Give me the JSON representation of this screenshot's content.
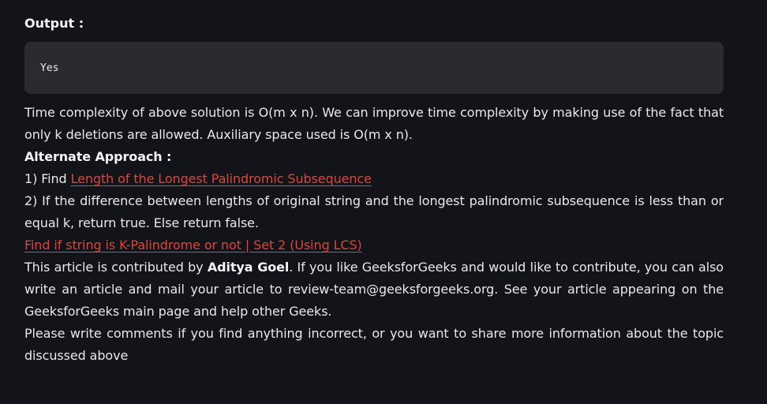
{
  "output_heading": "Output :",
  "output_code": "Yes",
  "complexity_text": "Time complexity of above solution is O(m x n). We can improve time complexity by making use of the fact that only k deletions are allowed. Auxiliary space used is O(m x n).",
  "alternate_heading": "Alternate Approach :",
  "step1_prefix": "1) Find ",
  "step1_link": "Length of the Longest Palindromic Subsequence",
  "step2_text": "2) If the difference between lengths of original string and the longest palindromic subsequence is less than or equal k, return true. Else return false.",
  "set2_link": "Find if string is K-Palindrome or not | Set 2 (Using LCS)",
  "contrib_prefix": "This article is contributed by ",
  "contrib_author": "Aditya Goel",
  "contrib_suffix": ". If you like GeeksforGeeks and would like to contribute, you can also write an article and mail your article to review-team@geeksforgeeks.org. See your article appearing on the GeeksforGeeks main page and help other Geeks.",
  "comments_text": "Please write comments if you find anything incorrect, or you want to share more information about the topic discussed above",
  "colors": {
    "background": "#131419",
    "code_background": "#2a2b31",
    "link": "#e0443a",
    "text": "#e8e9ec"
  }
}
